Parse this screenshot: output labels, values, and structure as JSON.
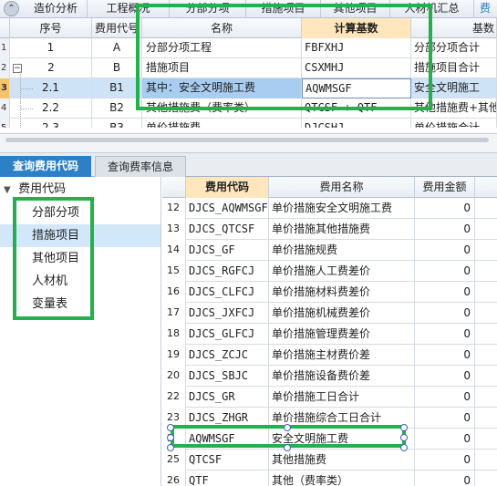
{
  "top_tabs": [
    "造价分析",
    "工程概况",
    "分部分项",
    "措施项目",
    "其他项目",
    "人材机汇总",
    "费"
  ],
  "upper_grid": {
    "headers": [
      "序号",
      "费用代号",
      "名称",
      "计算基数",
      "基数"
    ],
    "rows": [
      {
        "n": "1",
        "seq": "1",
        "code": "A",
        "name": "分部分项工程",
        "base": "FBFXHJ",
        "desc": "分部分项合计"
      },
      {
        "n": "2",
        "seq": "2",
        "code": "B",
        "name": "措施项目",
        "base": "CSXMHJ",
        "desc": "措施项目合计"
      },
      {
        "n": "3",
        "seq": "2.1",
        "code": "B1",
        "name": "其中：安全文明施工费",
        "base": "AQWMSGF",
        "desc": "安全文明施工"
      },
      {
        "n": "4",
        "seq": "2.2",
        "code": "B2",
        "name": "其他措施费（费率类）",
        "base": "QTCSF + QTF",
        "desc": "其他措施费+其他"
      },
      {
        "n": "5",
        "seq": "2.3",
        "code": "B3",
        "name": "单价措施费",
        "base": "DJCSHJ",
        "desc": "单价措施合计"
      }
    ]
  },
  "lower_tabs": [
    "查询费用代码",
    "查询费率信息"
  ],
  "tree": {
    "root": "费用代码",
    "items": [
      "分部分项",
      "措施项目",
      "其他项目",
      "人材机",
      "变量表"
    ],
    "selected_index": 1
  },
  "code_table": {
    "headers": [
      "费用代码",
      "费用名称",
      "费用金额"
    ],
    "rows": [
      {
        "n": "12",
        "code": "DJCS_AQWMSGF",
        "name": "单价措施安全文明施工费",
        "amount": "0"
      },
      {
        "n": "13",
        "code": "DJCS_QTCSF",
        "name": "单价措施其他措施费",
        "amount": "0"
      },
      {
        "n": "14",
        "code": "DJCS_GF",
        "name": "单价措施规费",
        "amount": "0"
      },
      {
        "n": "15",
        "code": "DJCS_RGFCJ",
        "name": "单价措施人工费差价",
        "amount": "0"
      },
      {
        "n": "16",
        "code": "DJCS_CLFCJ",
        "name": "单价措施材料费差价",
        "amount": "0"
      },
      {
        "n": "17",
        "code": "DJCS_JXFCJ",
        "name": "单价措施机械费差价",
        "amount": "0"
      },
      {
        "n": "18",
        "code": "DJCS_GLFCJ",
        "name": "单价措施管理费差价",
        "amount": "0"
      },
      {
        "n": "19",
        "code": "DJCS_ZCJC",
        "name": "单价措施主材费价差",
        "amount": "0"
      },
      {
        "n": "20",
        "code": "DJCS_SBJC",
        "name": "单价措施设备费价差",
        "amount": "0"
      },
      {
        "n": "22",
        "code": "DJCS_GR",
        "name": "单价措施工日合计",
        "amount": "0"
      },
      {
        "n": "23",
        "code": "DJCS_ZHGR",
        "name": "单价措施综合工日合计",
        "amount": "0"
      },
      {
        "n": "3",
        "code": "AQWMSGF",
        "name": "安全文明施工费",
        "amount": "0"
      },
      {
        "n": "25",
        "code": "QTCSF",
        "name": "其他措施费",
        "amount": "0"
      },
      {
        "n": "26",
        "code": "QTF",
        "name": "其他（费率类）",
        "amount": "0"
      }
    ]
  },
  "colors": {
    "accent_tab": "#2d7fc6",
    "annotation": "#22b14c",
    "selected_row": "#cfe3f7",
    "highlight_header": "#ffe6bd"
  }
}
